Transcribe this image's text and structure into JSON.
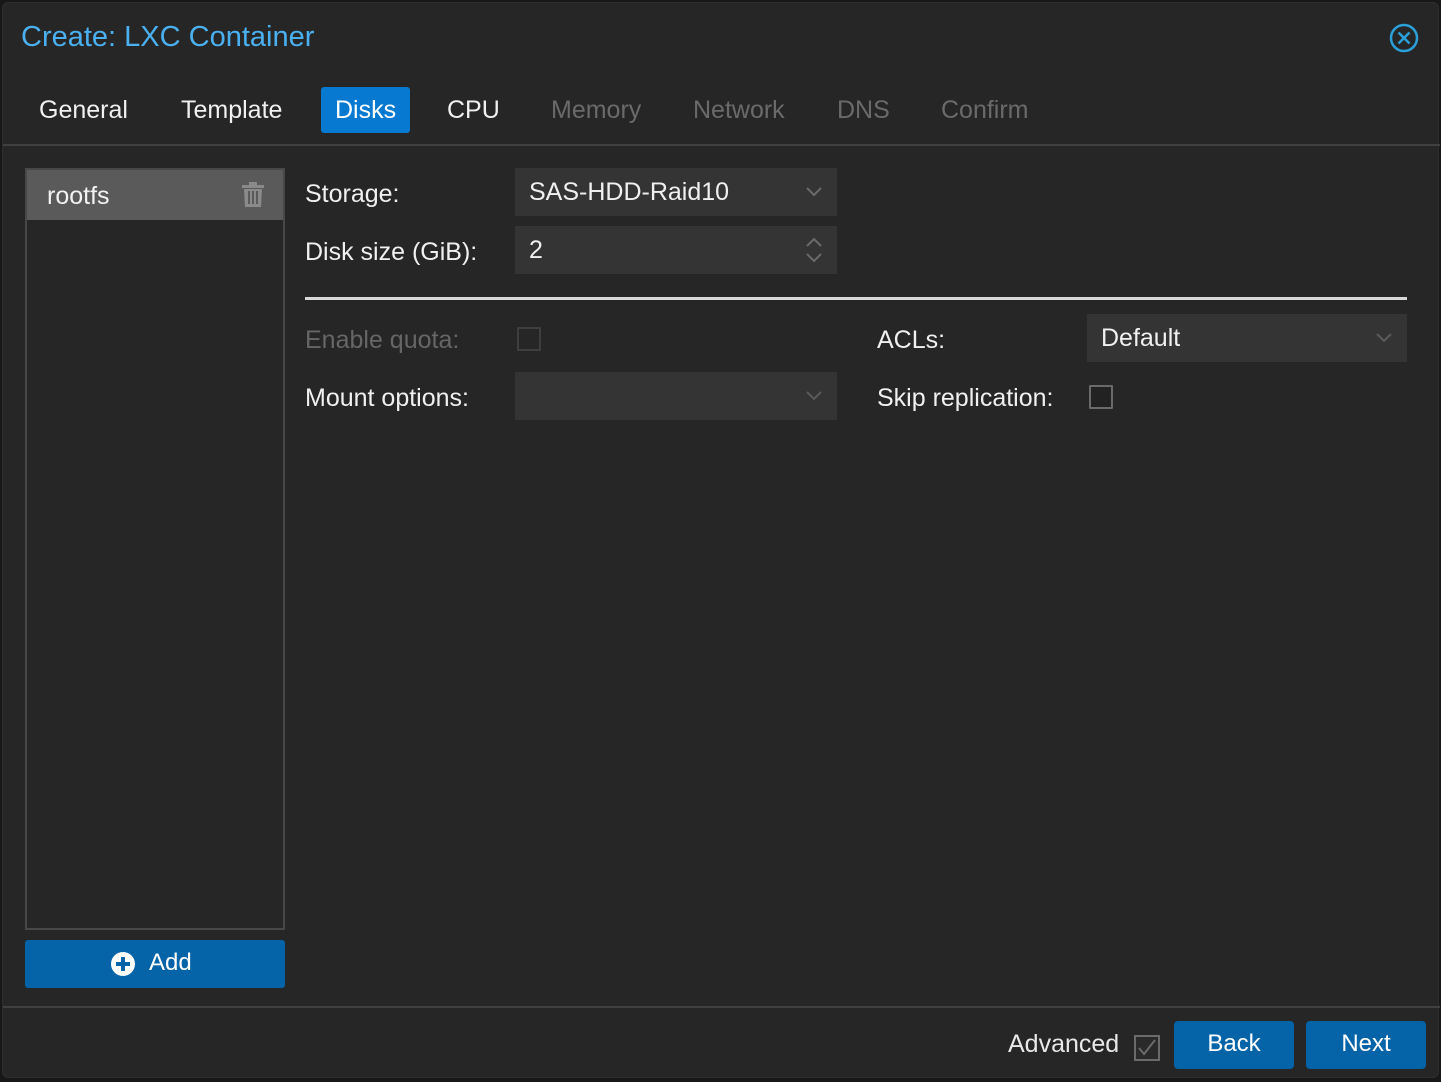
{
  "dialog": {
    "title": "Create: LXC Container",
    "close_icon": "close-circle-icon"
  },
  "tabs": [
    {
      "label": "General",
      "state": "enabled"
    },
    {
      "label": "Template",
      "state": "enabled"
    },
    {
      "label": "Disks",
      "state": "active"
    },
    {
      "label": "CPU",
      "state": "enabled"
    },
    {
      "label": "Memory",
      "state": "disabled"
    },
    {
      "label": "Network",
      "state": "disabled"
    },
    {
      "label": "DNS",
      "state": "disabled"
    },
    {
      "label": "Confirm",
      "state": "disabled"
    }
  ],
  "disks": {
    "items": [
      {
        "label": "rootfs",
        "icon": "trash-icon"
      }
    ],
    "add_label": "Add",
    "add_icon": "plus-circle-icon"
  },
  "form": {
    "storage": {
      "label": "Storage:",
      "value": "SAS-HDD-Raid10"
    },
    "disk_size": {
      "label": "Disk size (GiB):",
      "value": "2"
    },
    "enable_quota": {
      "label": "Enable quota:",
      "checked": false,
      "disabled": true
    },
    "mount_options": {
      "label": "Mount options:",
      "value": ""
    },
    "acls": {
      "label": "ACLs:",
      "value": "Default"
    },
    "skip_replication": {
      "label": "Skip replication:",
      "checked": false
    }
  },
  "footer": {
    "advanced_label": "Advanced",
    "advanced_checked": true,
    "back_label": "Back",
    "next_label": "Next"
  },
  "colors": {
    "accent": "#0779d0",
    "button": "#0563a8",
    "title": "#4ab0f0"
  }
}
